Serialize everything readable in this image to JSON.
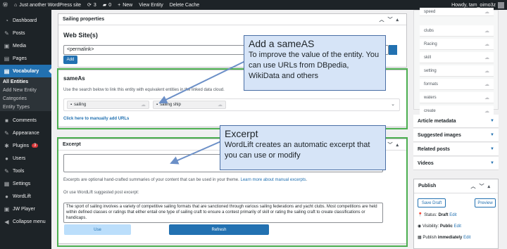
{
  "topbar": {
    "site": "Just another WordPress site",
    "updates": "3",
    "comments": "0",
    "new": "New",
    "view": "View Entity",
    "cache": "Delete Cache",
    "howdy": "Howdy, tam_oimo3z"
  },
  "sidebar": {
    "items": [
      {
        "label": "Dashboard",
        "icon": "dashboard-icon",
        "glyph": "◔"
      },
      {
        "label": "Posts",
        "icon": "pin-icon",
        "glyph": "✎"
      },
      {
        "label": "Media",
        "icon": "media-icon",
        "glyph": "▣"
      },
      {
        "label": "Pages",
        "icon": "pages-icon",
        "glyph": "▤"
      },
      {
        "label": "Vocabulary",
        "icon": "vocabulary-icon",
        "glyph": "▤"
      }
    ],
    "submenu": [
      "All Entities",
      "Add New Entity",
      "Categories",
      "Entity Types"
    ],
    "items2": [
      {
        "label": "Comments",
        "icon": "comments-icon",
        "glyph": "■"
      },
      {
        "label": "Appearance",
        "icon": "appearance-icon",
        "glyph": "✎"
      },
      {
        "label": "Plugins",
        "icon": "plugins-icon",
        "glyph": "✱",
        "badge": "3"
      },
      {
        "label": "Users",
        "icon": "users-icon",
        "glyph": "●"
      },
      {
        "label": "Tools",
        "icon": "tools-icon",
        "glyph": "✎"
      },
      {
        "label": "Settings",
        "icon": "settings-icon",
        "glyph": "▦"
      },
      {
        "label": "WordLift",
        "icon": "wordlift-icon",
        "glyph": "●"
      },
      {
        "label": "JW Player",
        "icon": "jwplayer-icon",
        "glyph": "▣"
      },
      {
        "label": "Collapse menu",
        "icon": "collapse-icon",
        "glyph": "◀"
      }
    ]
  },
  "sailing": {
    "title": "Sailing properties",
    "website_heading": "Web Site(s)",
    "permalink": "<permalink>",
    "add": "Add"
  },
  "sameas": {
    "title": "sameAs",
    "help": "Use the search below to link this entity with equivalent entities in the linked data cloud.",
    "tags": [
      "sailing",
      "sailing ship"
    ],
    "manual": "Click here to manually add URLs"
  },
  "callout1": {
    "title": "Add a sameAS",
    "body": "To improve the value of the entity. You can use URLs from DBpedia, WikiData and others"
  },
  "excerpt": {
    "title": "Excerpt",
    "help_prefix": "Excerpts are optional hand-crafted summaries of your content that can be used in your theme. ",
    "help_link": "Learn more about manual excerpts",
    "help_suffix": ".",
    "suggest": "Or use WordLift suggested post excerpt:",
    "text": "The sport of sailing involves a variety of competitive sailing formats that are sanctioned through various sailing federations and yacht clubs. Most competitions are held within defined classes or ratings that either entail one type of sailing craft to ensure a contest primarily of skill or rating the sailing craft to create classifications or handicaps.",
    "use": "Use",
    "refresh": "Refresh"
  },
  "callout2": {
    "title": "Excerpt",
    "body": "WordLift creates an automatic excerpt that you can use or modify"
  },
  "right": {
    "types": [
      "speed",
      "clubs",
      "Racing",
      "skill",
      "setting",
      "formats",
      "waters",
      "create"
    ],
    "boxes": [
      "Article metadata",
      "Suggested images",
      "Related posts",
      "Videos"
    ],
    "publish": {
      "title": "Publish",
      "save": "Save Draft",
      "preview": "Preview",
      "status_label": "Status: ",
      "status": "Draft",
      "visibility_label": "Visibility: ",
      "visibility": "Public",
      "publish_label": "Publish ",
      "publish_when": "immediately",
      "edit": "Edit"
    }
  }
}
